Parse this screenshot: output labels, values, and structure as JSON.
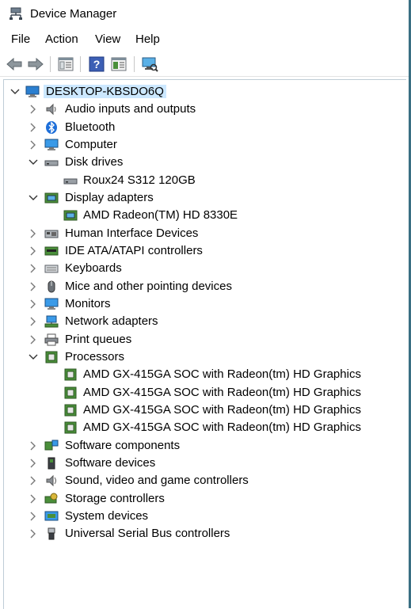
{
  "window": {
    "title": "Device Manager"
  },
  "menu": [
    "File",
    "Action",
    "View",
    "Help"
  ],
  "toolbar": [
    "back-icon",
    "forward-icon",
    "properties-icon",
    "help-icon",
    "view-icon",
    "scan-hardware-icon"
  ],
  "tree": {
    "root": "DESKTOP-KBSDO6Q",
    "items": [
      {
        "label": "Audio inputs and outputs",
        "icon": "speaker-icon",
        "expanded": false,
        "children": []
      },
      {
        "label": "Bluetooth",
        "icon": "bluetooth-icon",
        "expanded": false,
        "children": []
      },
      {
        "label": "Computer",
        "icon": "computer-icon",
        "expanded": false,
        "children": []
      },
      {
        "label": "Disk drives",
        "icon": "disk-drive-icon",
        "expanded": true,
        "children": [
          "Roux24 S312 120GB"
        ]
      },
      {
        "label": "Display adapters",
        "icon": "display-adapter-icon",
        "expanded": true,
        "children": [
          "AMD Radeon(TM) HD 8330E"
        ]
      },
      {
        "label": "Human Interface Devices",
        "icon": "hid-icon",
        "expanded": false,
        "children": []
      },
      {
        "label": "IDE ATA/ATAPI controllers",
        "icon": "ide-controller-icon",
        "expanded": false,
        "children": []
      },
      {
        "label": "Keyboards",
        "icon": "keyboard-icon",
        "expanded": false,
        "children": []
      },
      {
        "label": "Mice and other pointing devices",
        "icon": "mouse-icon",
        "expanded": false,
        "children": []
      },
      {
        "label": "Monitors",
        "icon": "monitor-icon",
        "expanded": false,
        "children": []
      },
      {
        "label": "Network adapters",
        "icon": "network-adapter-icon",
        "expanded": false,
        "children": []
      },
      {
        "label": "Print queues",
        "icon": "printer-icon",
        "expanded": false,
        "children": []
      },
      {
        "label": "Processors",
        "icon": "processor-icon",
        "expanded": true,
        "children": [
          "AMD GX-415GA SOC with Radeon(tm) HD Graphics",
          "AMD GX-415GA SOC with Radeon(tm) HD Graphics",
          "AMD GX-415GA SOC with Radeon(tm) HD Graphics",
          "AMD GX-415GA SOC with Radeon(tm) HD Graphics"
        ]
      },
      {
        "label": "Software components",
        "icon": "software-component-icon",
        "expanded": false,
        "children": []
      },
      {
        "label": "Software devices",
        "icon": "software-device-icon",
        "expanded": false,
        "children": []
      },
      {
        "label": "Sound, video and game controllers",
        "icon": "sound-icon",
        "expanded": false,
        "children": []
      },
      {
        "label": "Storage controllers",
        "icon": "storage-controller-icon",
        "expanded": false,
        "children": []
      },
      {
        "label": "System devices",
        "icon": "system-device-icon",
        "expanded": false,
        "children": []
      },
      {
        "label": "Universal Serial Bus controllers",
        "icon": "usb-icon",
        "expanded": false,
        "children": []
      }
    ]
  }
}
